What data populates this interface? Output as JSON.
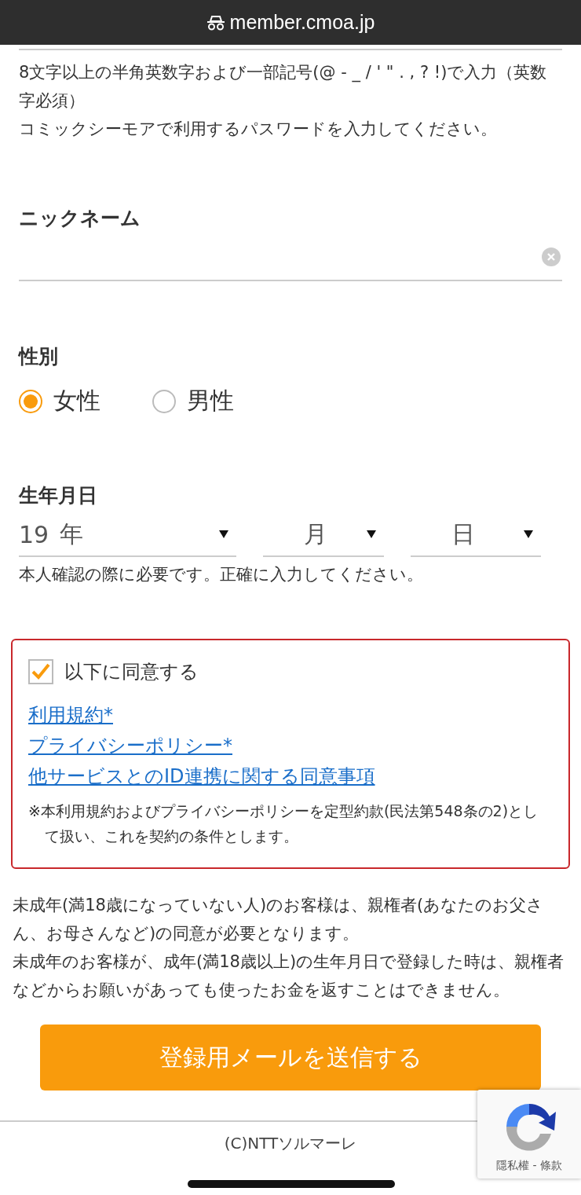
{
  "address_bar": {
    "url": "member.cmoa.jp"
  },
  "password_notes": [
    "8文字以上の半角英数字および一部記号(@ - _ / ' \" . , ? !)で入力（英数字必須）",
    "コミックシーモアで利用するパスワードを入力してください。"
  ],
  "nickname": {
    "label": "ニックネーム"
  },
  "gender": {
    "label": "性別",
    "options": [
      {
        "label": "女性",
        "selected": true
      },
      {
        "label": "男性",
        "selected": false
      }
    ]
  },
  "birthday": {
    "label": "生年月日",
    "selects": [
      {
        "value": "19",
        "unit": "年"
      },
      {
        "unit": "月"
      },
      {
        "unit": "日"
      }
    ],
    "note": "本人確認の際に必要です。正確に入力してください。"
  },
  "agreement": {
    "label": "以下に同意する",
    "checked": true,
    "links": [
      "利用規約*",
      "プライバシーポリシー*",
      "他サービスとのID連携に関する同意事項"
    ],
    "note": "※本利用規約およびプライバシーポリシーを定型約款(民法第548条の2)として扱い、これを契約の条件とします。"
  },
  "minor_notice": [
    "未成年(満18歳になっていない人)のお客様は、親権者(あなたのお父さん、お母さんなど)の同意が必要となります。",
    "未成年のお客様が、成年(満18歳以上)の生年月日で登録した時は、親権者などからお願いがあっても使ったお金を返すことはできません。"
  ],
  "submit_button": "登録用メールを送信する",
  "recaptcha": {
    "links": "隱私權 - 條款"
  },
  "footer": "(C)NTTソルマーレ"
}
